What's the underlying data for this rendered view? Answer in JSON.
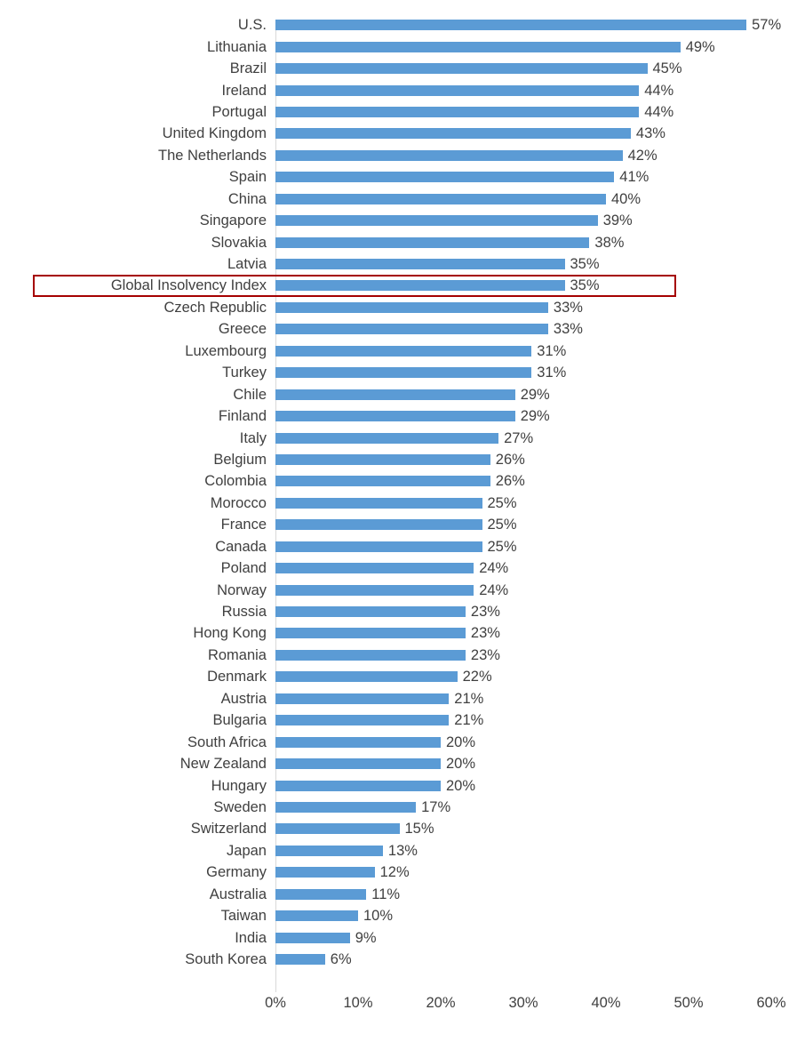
{
  "chart_data": {
    "type": "bar",
    "orientation": "horizontal",
    "title": "",
    "subtitle": "",
    "xlabel": "",
    "ylabel": "",
    "xlim": [
      0,
      60
    ],
    "x_tick_labels": [
      "0%",
      "10%",
      "20%",
      "30%",
      "40%",
      "50%",
      "60%"
    ],
    "x_ticks": [
      0,
      10,
      20,
      30,
      40,
      50,
      60
    ],
    "grid": false,
    "legend": null,
    "value_suffix": "%",
    "bar_color": "#5B9BD5",
    "highlight_color": "#A50000",
    "highlight_category": "Global Insolvency Index",
    "categories": [
      "U.S.",
      "Lithuania",
      "Brazil",
      "Ireland",
      "Portugal",
      "United Kingdom",
      "The Netherlands",
      "Spain",
      "China",
      "Singapore",
      "Slovakia",
      "Latvia",
      "Global Insolvency Index",
      "Czech Republic",
      "Greece",
      "Luxembourg",
      "Turkey",
      "Chile",
      "Finland",
      "Italy",
      "Belgium",
      "Colombia",
      "Morocco",
      "France",
      "Canada",
      "Poland",
      "Norway",
      "Russia",
      "Hong Kong",
      "Romania",
      "Denmark",
      "Austria",
      "Bulgaria",
      "South Africa",
      "New Zealand",
      "Hungary",
      "Sweden",
      "Switzerland",
      "Japan",
      "Germany",
      "Australia",
      "Taiwan",
      "India",
      "South Korea"
    ],
    "values": [
      57,
      49,
      45,
      44,
      44,
      43,
      42,
      41,
      40,
      39,
      38,
      35,
      35,
      33,
      33,
      31,
      31,
      29,
      29,
      27,
      26,
      26,
      25,
      25,
      25,
      24,
      24,
      23,
      23,
      23,
      22,
      21,
      21,
      20,
      20,
      20,
      17,
      15,
      13,
      12,
      11,
      10,
      9,
      6
    ],
    "value_labels": [
      "57%",
      "49%",
      "45%",
      "44%",
      "44%",
      "43%",
      "42%",
      "41%",
      "40%",
      "39%",
      "38%",
      "35%",
      "35%",
      "33%",
      "33%",
      "31%",
      "31%",
      "29%",
      "29%",
      "27%",
      "26%",
      "26%",
      "25%",
      "25%",
      "25%",
      "24%",
      "24%",
      "23%",
      "23%",
      "23%",
      "22%",
      "21%",
      "21%",
      "20%",
      "20%",
      "20%",
      "17%",
      "15%",
      "13%",
      "12%",
      "11%",
      "10%",
      "9%",
      "6%"
    ]
  }
}
